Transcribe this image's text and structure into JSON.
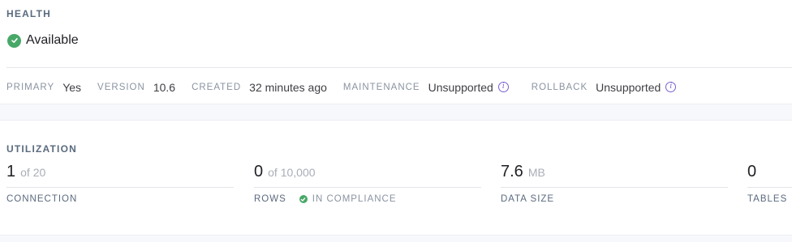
{
  "health": {
    "title": "HEALTH",
    "status": "Available",
    "status_icon": "check-circle-icon",
    "meta": {
      "primary_key": "PRIMARY",
      "primary_val": "Yes",
      "version_key": "VERSION",
      "version_val": "10.6",
      "created_key": "CREATED",
      "created_val": "32 minutes ago",
      "maintenance_key": "MAINTENANCE",
      "maintenance_val": "Unsupported",
      "rollback_key": "ROLLBACK",
      "rollback_val": "Unsupported"
    }
  },
  "utilization": {
    "title": "UTILIZATION",
    "connection": {
      "value": "1",
      "sub": "of 20",
      "label": "CONNECTION"
    },
    "rows": {
      "value": "0",
      "sub": "of 10,000",
      "label": "ROWS",
      "compliance": "IN COMPLIANCE"
    },
    "data_size": {
      "value": "7.6",
      "sub": "MB",
      "label": "DATA SIZE"
    },
    "tables": {
      "value": "0",
      "sub": "",
      "label": "TABLES"
    }
  },
  "colors": {
    "success": "#48a868",
    "info": "#7a5fd0",
    "muted": "#8a93a1"
  }
}
